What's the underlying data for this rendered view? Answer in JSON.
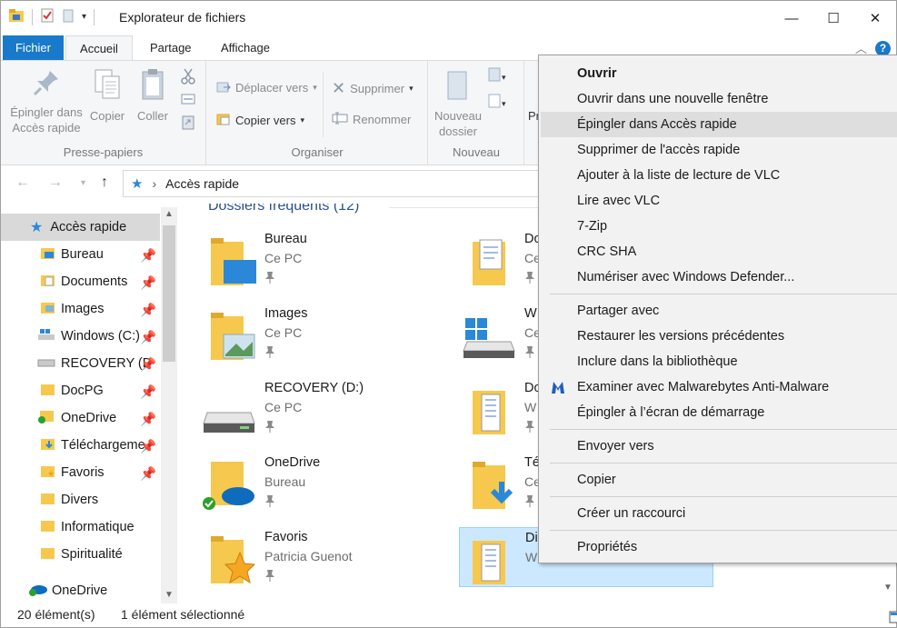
{
  "window": {
    "title": "Explorateur de fichiers",
    "controls": {
      "minimize": "—",
      "maximize": "☐",
      "close": "✕"
    }
  },
  "ribbon_tabs": {
    "file": "Fichier",
    "home": "Accueil",
    "share": "Partage",
    "view": "Affichage",
    "help": "?"
  },
  "ribbon": {
    "clipboard": {
      "label": "Presse-papiers",
      "pin_line1": "Épingler dans",
      "pin_line2": "Accès rapide",
      "copy": "Copier",
      "paste": "Coller"
    },
    "organize": {
      "label": "Organiser",
      "move_to": "Déplacer vers",
      "copy_to": "Copier vers",
      "delete": "Supprimer",
      "rename": "Renommer"
    },
    "new": {
      "label": "Nouveau",
      "new_folder_line1": "Nouveau",
      "new_folder_line2": "dossier"
    },
    "partial": "Pr"
  },
  "address": {
    "path": "Accès rapide",
    "separator": "›"
  },
  "sidebar": {
    "items": [
      {
        "label": "Accès rapide",
        "pinned": false
      },
      {
        "label": "Bureau",
        "pinned": true
      },
      {
        "label": "Documents",
        "pinned": true
      },
      {
        "label": "Images",
        "pinned": true
      },
      {
        "label": "Windows (C:)",
        "pinned": true
      },
      {
        "label": "RECOVERY (D",
        "pinned": true
      },
      {
        "label": "DocPG",
        "pinned": true
      },
      {
        "label": "OneDrive",
        "pinned": true
      },
      {
        "label": "Téléchargeme",
        "pinned": true
      },
      {
        "label": "Favoris",
        "pinned": true
      },
      {
        "label": "Divers",
        "pinned": false
      },
      {
        "label": "Informatique",
        "pinned": false
      },
      {
        "label": "Spiritualité",
        "pinned": false
      },
      {
        "label": "OneDrive",
        "pinned": false
      }
    ]
  },
  "main": {
    "section": "Dossiers fréquents (12)",
    "left_tiles": [
      {
        "name": "Bureau",
        "sub": "Ce PC"
      },
      {
        "name": "Images",
        "sub": "Ce PC"
      },
      {
        "name": "RECOVERY (D:)",
        "sub": "Ce PC"
      },
      {
        "name": "OneDrive",
        "sub": "Bureau"
      },
      {
        "name": "Favoris",
        "sub": "Patricia Guenot"
      }
    ],
    "right_tiles": [
      {
        "name": "Do",
        "sub": "Ce"
      },
      {
        "name": "W",
        "sub": "Ce"
      },
      {
        "name": "Do",
        "sub": "W"
      },
      {
        "name": "Té",
        "sub": "Ce"
      },
      {
        "name": "Di",
        "sub": "W"
      }
    ]
  },
  "status": {
    "count": "20 élément(s)",
    "selected": "1 élément sélectionné"
  },
  "context_menu": {
    "items": [
      "Ouvrir",
      "Ouvrir dans une nouvelle fenêtre",
      "Épingler dans Accès rapide",
      "Supprimer de l'accès rapide",
      "Ajouter à la liste de lecture de VLC",
      "Lire avec VLC",
      "7-Zip",
      "CRC SHA",
      "Numériser avec Windows Defender...",
      "Partager avec",
      "Restaurer les versions précédentes",
      "Inclure dans la bibliothèque",
      "Examiner avec Malwarebytes Anti-Malware",
      "Épingler à l’écran de démarrage",
      "Envoyer vers",
      "Copier",
      "Créer un raccourci",
      "Propriétés"
    ]
  },
  "colors": {
    "accent": "#1979ca",
    "selection": "#cce8ff",
    "folder": "#f6c94e",
    "menu_bg": "#f2f2f2"
  }
}
